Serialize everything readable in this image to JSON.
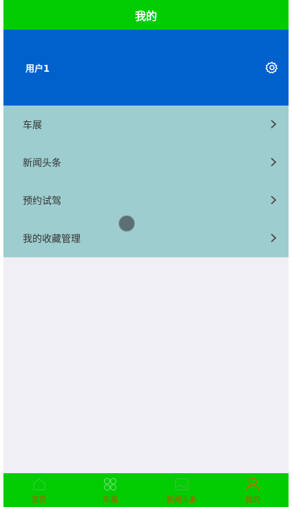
{
  "header": {
    "title": "我的"
  },
  "user": {
    "name": "用户1",
    "settings_icon": "gear-icon"
  },
  "menu": {
    "items": [
      {
        "label": "车展",
        "icon": "chevron-right-icon"
      },
      {
        "label": "新闻头条",
        "icon": "chevron-right-icon"
      },
      {
        "label": "预约试驾",
        "icon": "chevron-right-icon"
      },
      {
        "label": "我的收藏管理",
        "icon": "chevron-right-icon"
      }
    ]
  },
  "tabbar": {
    "tabs": [
      {
        "label": "首页",
        "icon": "home-icon"
      },
      {
        "label": "车展",
        "icon": "grid-icon"
      },
      {
        "label": "新闻头条",
        "icon": "news-icon"
      },
      {
        "label": "我的",
        "icon": "person-icon"
      }
    ]
  },
  "colors": {
    "header": "#00cc00",
    "user_panel": "#0060cc",
    "menu_bg": "#9ecdcf",
    "page_bg": "#f0eff4",
    "tab_label": "#b35a00"
  }
}
